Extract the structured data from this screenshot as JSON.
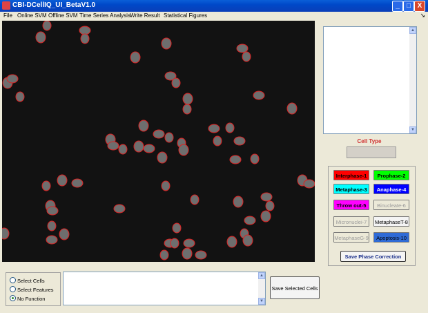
{
  "window": {
    "title": "CBI-DCellIQ_UI_BetaV1.0",
    "minimize": "_",
    "maximize": "□",
    "close": "X"
  },
  "menu": [
    "File",
    "Online SVM",
    "Offline SVM",
    "Time Series Analysis",
    "Write Result",
    "Statistical Figures"
  ],
  "menu_pin": "↘",
  "cell_type": {
    "label": "Cell Type",
    "value": ""
  },
  "phase_buttons": [
    {
      "label": "Interphase-1",
      "bg": "#ff0000",
      "color": "#000000",
      "bold": true
    },
    {
      "label": "Prophase-2",
      "bg": "#00ff00",
      "color": "#000000",
      "bold": true
    },
    {
      "label": "Metaphase-3",
      "bg": "#00ffff",
      "color": "#000000",
      "bold": true
    },
    {
      "label": "Anaphase-4",
      "bg": "#0000ff",
      "color": "#ffffff",
      "bold": true
    },
    {
      "label": "Throw out-5",
      "bg": "#ff00ff",
      "color": "#000000",
      "bold": true
    },
    {
      "label": "Binucleate-6",
      "bg": "#ece9d8",
      "color": "#9a9a9a",
      "bold": false
    },
    {
      "label": "Micronuclei-7",
      "bg": "#ece9d8",
      "color": "#9a9a9a",
      "bold": false
    },
    {
      "label": "MetaphaseT-8",
      "bg": "#f4f4f4",
      "color": "#000000",
      "bold": false
    },
    {
      "label": "MetaphaseG-9",
      "bg": "#ece9d8",
      "color": "#9a9a9a",
      "bold": false
    },
    {
      "label": "Apoptosis-10",
      "bg": "#2f6bd6",
      "color": "#000000",
      "bold": false
    }
  ],
  "save_phase_label": "Save Phase Correction",
  "radio_options": [
    {
      "label": "Select Cells",
      "selected": false
    },
    {
      "label": "Select Features",
      "selected": false
    },
    {
      "label": "No Function",
      "selected": true
    }
  ],
  "save_cells_label": "Save Selected Cells",
  "colors": {
    "cell_outline": "#e02020",
    "image_bg": "#121212",
    "title_bar": "#0a4fcf"
  }
}
